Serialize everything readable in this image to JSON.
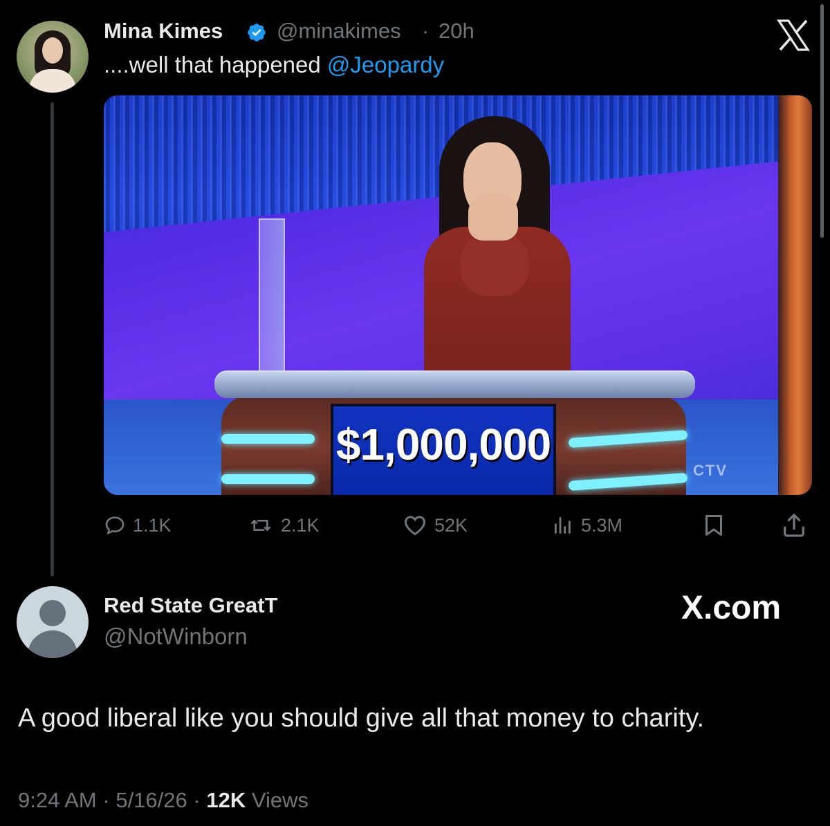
{
  "tweet": {
    "author_name": "Mina Kimes",
    "author_handle": "@minakimes",
    "separator": "·",
    "time_ago": "20h",
    "text_prefix": "....well that happened",
    "text_mention": "@Jeopardy",
    "media": {
      "screen_text": "$1,000,000",
      "watermark": "CTV"
    },
    "stats": {
      "replies": "1.1K",
      "retweets": "2.1K",
      "likes": "52K",
      "views": "5.3M"
    }
  },
  "reply": {
    "author_name": "Red State GreatT",
    "author_handle": "@NotWinborn",
    "text": "A good liberal like you should give all that money to charity.",
    "time": "9:24 AM",
    "separator": "·",
    "date": "5/16/26",
    "views_count": "12K",
    "views_label": "Views"
  },
  "brand": {
    "watermark": "X.com"
  },
  "icons": {
    "top_right": "x-logo-icon",
    "verified": "verified-badge-icon",
    "reply": "reply-icon",
    "retweet": "retweet-icon",
    "like": "heart-icon",
    "views": "views-icon",
    "bookmark": "bookmark-icon",
    "share": "share-icon"
  },
  "colors": {
    "background": "#000000",
    "text": "#e7e9ea",
    "muted": "#71767b",
    "accent": "#1d9bf0"
  }
}
